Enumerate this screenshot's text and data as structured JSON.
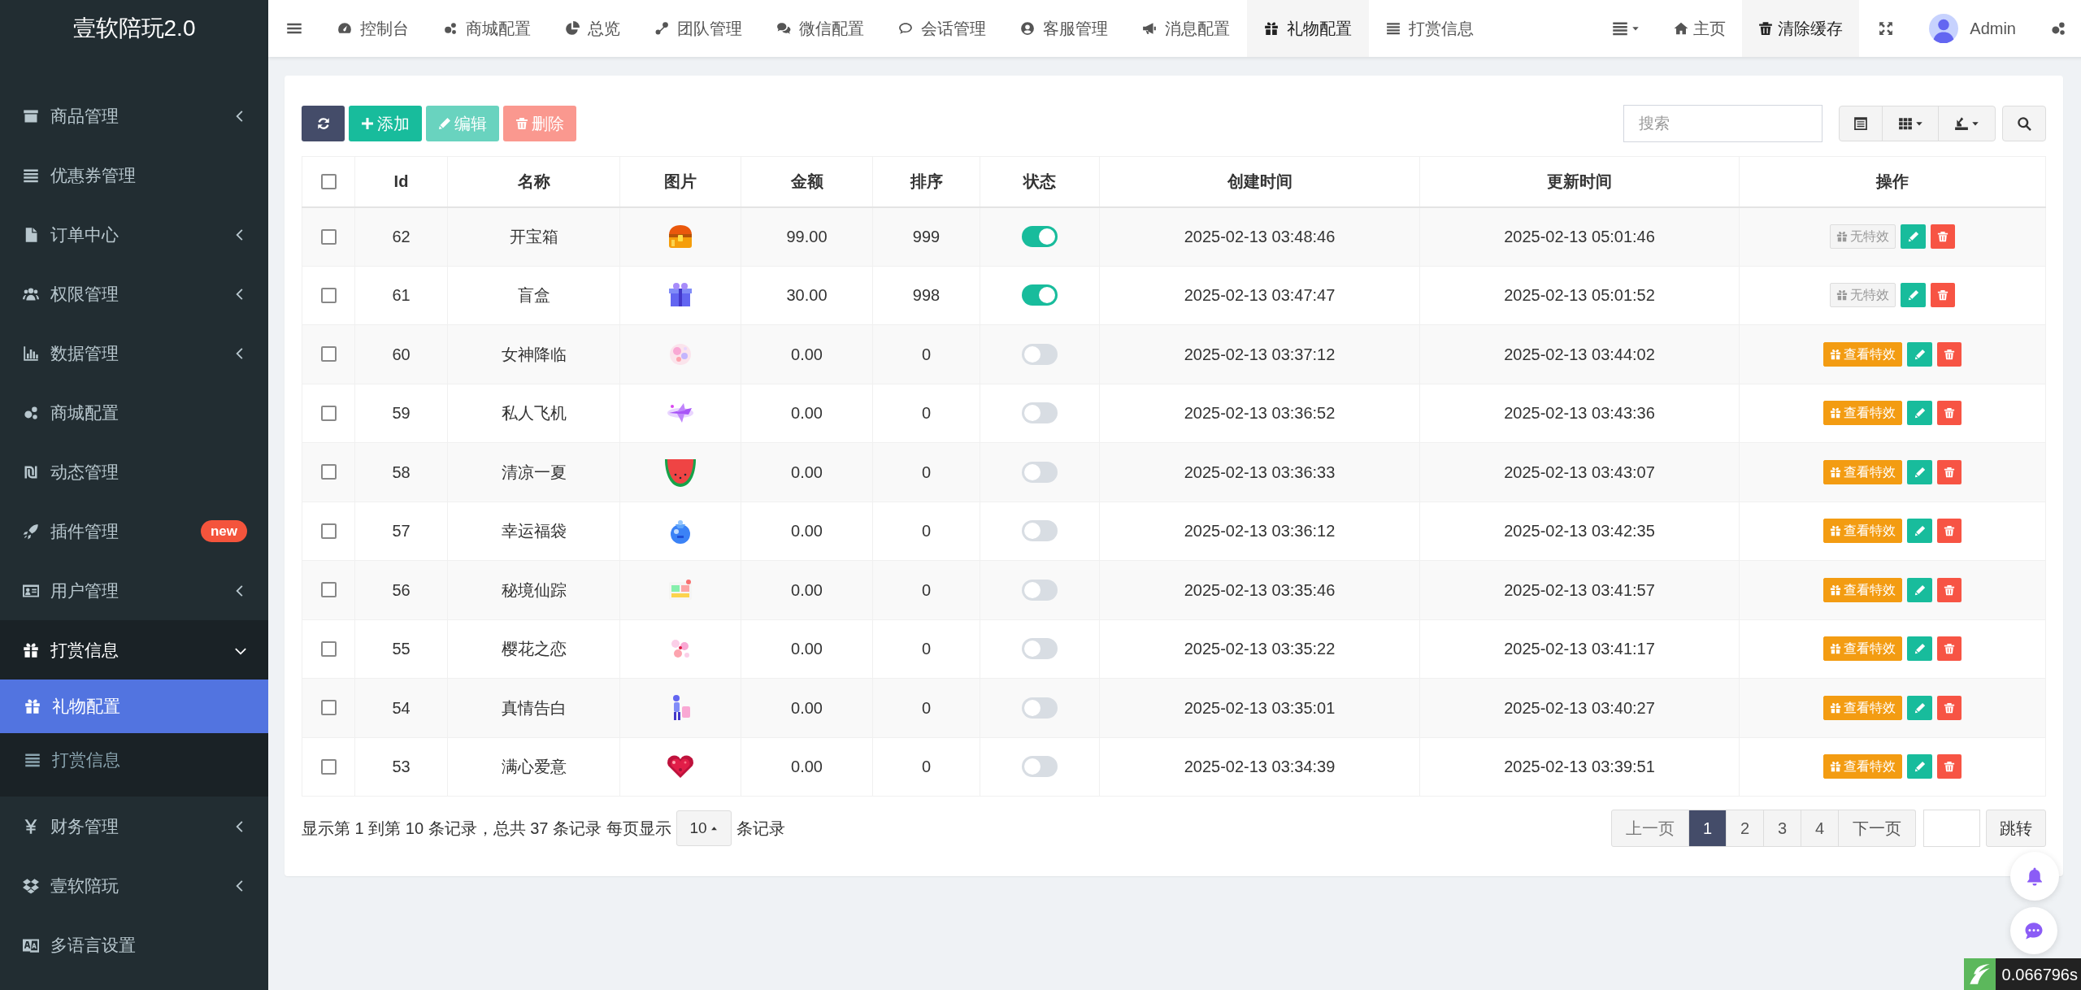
{
  "sidebar": {
    "logo": "壹软陪玩2.0",
    "items": [
      {
        "label": "商品管理",
        "has_children": true,
        "expanded": false,
        "selected": false
      },
      {
        "label": "优惠券管理",
        "has_children": false,
        "expanded": false,
        "selected": false
      },
      {
        "label": "订单中心",
        "has_children": true,
        "expanded": false,
        "selected": false
      },
      {
        "label": "权限管理",
        "has_children": true,
        "expanded": false,
        "selected": false
      },
      {
        "label": "数据管理",
        "has_children": true,
        "expanded": false,
        "selected": false
      },
      {
        "label": "商城配置",
        "has_children": false,
        "expanded": false,
        "selected": false
      },
      {
        "label": "动态管理",
        "has_children": false,
        "expanded": false,
        "selected": false
      },
      {
        "label": "插件管理",
        "has_children": false,
        "expanded": false,
        "selected": false,
        "badge": "new"
      },
      {
        "label": "用户管理",
        "has_children": true,
        "expanded": false,
        "selected": false
      },
      {
        "label": "打赏信息",
        "has_children": true,
        "expanded": true,
        "selected": false,
        "children": [
          {
            "label": "礼物配置",
            "selected": true
          },
          {
            "label": "打赏信息",
            "selected": false
          }
        ]
      },
      {
        "label": "财务管理",
        "has_children": true,
        "expanded": false,
        "selected": false
      },
      {
        "label": "壹软陪玩",
        "has_children": true,
        "expanded": false,
        "selected": false
      },
      {
        "label": "多语言设置",
        "has_children": false,
        "expanded": false,
        "selected": false
      }
    ]
  },
  "nav": {
    "tabs": [
      {
        "label": "控制台",
        "selected": false
      },
      {
        "label": "商城配置",
        "selected": false
      },
      {
        "label": "总览",
        "selected": false
      },
      {
        "label": "团队管理",
        "selected": false
      },
      {
        "label": "微信配置",
        "selected": false
      },
      {
        "label": "会话管理",
        "selected": false
      },
      {
        "label": "客服管理",
        "selected": false
      },
      {
        "label": "消息配置",
        "selected": false
      },
      {
        "label": "礼物配置",
        "selected": true
      },
      {
        "label": "打赏信息",
        "selected": false
      }
    ],
    "right": [
      {
        "label": "主页",
        "selected": false
      },
      {
        "label": "清除缓存",
        "selected": true
      }
    ],
    "user": "Admin"
  },
  "toolbar": {
    "buttons": [
      {
        "label": "添加",
        "disabled": false
      },
      {
        "label": "编辑",
        "disabled": true
      },
      {
        "label": "删除",
        "disabled": true
      }
    ],
    "search": {
      "placeholder": "搜索"
    }
  },
  "table": {
    "all_checked": false,
    "columns": [
      "Id",
      "名称",
      "图片",
      "金额",
      "排序",
      "状态",
      "创建时间",
      "更新时间",
      "操作"
    ],
    "rows": [
      {
        "checked": false,
        "id": "62",
        "name": "开宝箱",
        "amount": "99.00",
        "sort": "999",
        "on": true,
        "created": "2025-02-13 03:48:46",
        "updated": "2025-02-13 05:01:46",
        "effect": {
          "kind": "none",
          "label": "无特效"
        }
      },
      {
        "checked": false,
        "id": "61",
        "name": "盲盒",
        "amount": "30.00",
        "sort": "998",
        "on": true,
        "created": "2025-02-13 03:47:47",
        "updated": "2025-02-13 05:01:52",
        "effect": {
          "kind": "none",
          "label": "无特效"
        }
      },
      {
        "checked": false,
        "id": "60",
        "name": "女神降临",
        "amount": "0.00",
        "sort": "0",
        "on": false,
        "created": "2025-02-13 03:37:12",
        "updated": "2025-02-13 03:44:02",
        "effect": {
          "kind": "view",
          "label": "查看特效"
        }
      },
      {
        "checked": false,
        "id": "59",
        "name": "私人飞机",
        "amount": "0.00",
        "sort": "0",
        "on": false,
        "created": "2025-02-13 03:36:52",
        "updated": "2025-02-13 03:43:36",
        "effect": {
          "kind": "view",
          "label": "查看特效"
        }
      },
      {
        "checked": false,
        "id": "58",
        "name": "清凉一夏",
        "amount": "0.00",
        "sort": "0",
        "on": false,
        "created": "2025-02-13 03:36:33",
        "updated": "2025-02-13 03:43:07",
        "effect": {
          "kind": "view",
          "label": "查看特效"
        }
      },
      {
        "checked": false,
        "id": "57",
        "name": "幸运福袋",
        "amount": "0.00",
        "sort": "0",
        "on": false,
        "created": "2025-02-13 03:36:12",
        "updated": "2025-02-13 03:42:35",
        "effect": {
          "kind": "view",
          "label": "查看特效"
        }
      },
      {
        "checked": false,
        "id": "56",
        "name": "秘境仙踪",
        "amount": "0.00",
        "sort": "0",
        "on": false,
        "created": "2025-02-13 03:35:46",
        "updated": "2025-02-13 03:41:57",
        "effect": {
          "kind": "view",
          "label": "查看特效"
        }
      },
      {
        "checked": false,
        "id": "55",
        "name": "樱花之恋",
        "amount": "0.00",
        "sort": "0",
        "on": false,
        "created": "2025-02-13 03:35:22",
        "updated": "2025-02-13 03:41:17",
        "effect": {
          "kind": "view",
          "label": "查看特效"
        }
      },
      {
        "checked": false,
        "id": "54",
        "name": "真情告白",
        "amount": "0.00",
        "sort": "0",
        "on": false,
        "created": "2025-02-13 03:35:01",
        "updated": "2025-02-13 03:40:27",
        "effect": {
          "kind": "view",
          "label": "查看特效"
        }
      },
      {
        "checked": false,
        "id": "53",
        "name": "满心爱意",
        "amount": "0.00",
        "sort": "0",
        "on": false,
        "created": "2025-02-13 03:34:39",
        "updated": "2025-02-13 03:39:51",
        "effect": {
          "kind": "view",
          "label": "查看特效"
        }
      }
    ]
  },
  "pagination": {
    "summary": "显示第 1 到第 10 条记录，总共 37 条记录 每页显示",
    "page_size": "10",
    "suffix": "条记录",
    "prev": "上一页",
    "pages": [
      {
        "label": "1",
        "selected": true
      },
      {
        "label": "2",
        "selected": false
      },
      {
        "label": "3",
        "selected": false
      },
      {
        "label": "4",
        "selected": false
      }
    ],
    "next": "下一页",
    "jump": "跳转"
  },
  "timer": "0.066796s"
}
